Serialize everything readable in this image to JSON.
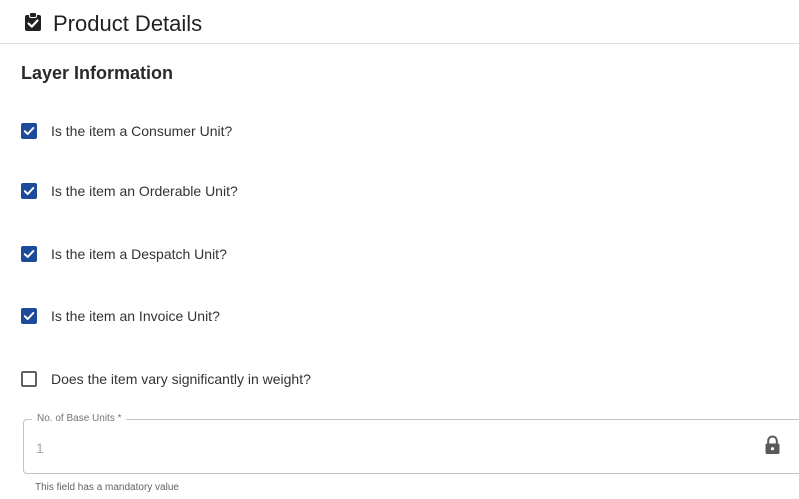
{
  "header": {
    "icon": "clipboard-check-icon",
    "title": "Product Details"
  },
  "section": {
    "title": "Layer Information"
  },
  "checkboxes": [
    {
      "label": "Is the item a Consumer Unit?",
      "checked": true
    },
    {
      "label": "Is the item an Orderable Unit?",
      "checked": true
    },
    {
      "label": "Is the item a Despatch Unit?",
      "checked": true
    },
    {
      "label": "Is the item an Invoice Unit?",
      "checked": true
    },
    {
      "label": "Does the item vary significantly in weight?",
      "checked": false
    }
  ],
  "base_units_field": {
    "label": "No. of Base Units *",
    "value": "1",
    "icon": "lock-icon",
    "helper_text": "This field has a mandatory value"
  },
  "colors": {
    "checkbox_accent": "#1b4b9a",
    "field_border": "#c4c4c4"
  }
}
